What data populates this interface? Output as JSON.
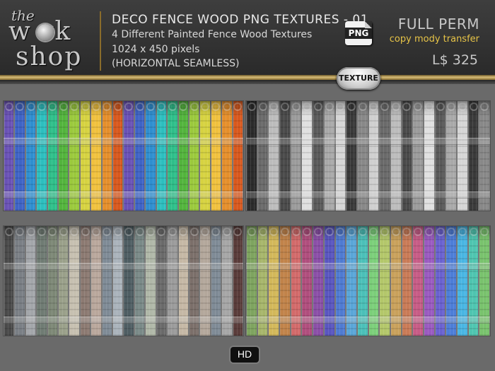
{
  "logo": {
    "line1": "the",
    "line2": "w rk",
    "line3": "shop"
  },
  "header": {
    "title": "DECO FENCE WOOD PNG TEXTURES - 01",
    "subtitle": "4 Different Painted Fence Wood Textures",
    "dimensions": "1024 x 450 pixels",
    "seamless": "(HORIZONTAL SEAMLESS)",
    "png_badge": "PNG",
    "perm_title": "FULL PERM",
    "perm_detail": "copy mody transfer",
    "price": "L$ 325"
  },
  "texture_badge": "TEXTURE",
  "hd_badge": "HD",
  "colors": {
    "accent_gold": "#d8bd78",
    "perm_yellow": "#e7c447",
    "text_light": "#e9e9e9"
  },
  "panels": [
    {
      "name": "rainbow-fence-panel",
      "planks": [
        "#6a52b6",
        "#3f64c6",
        "#2f8fd0",
        "#2dbfbf",
        "#2fbf8a",
        "#53b43d",
        "#9bc93d",
        "#d6d241",
        "#f0c13e",
        "#e58f2c",
        "#d8591e",
        "#6a52b6",
        "#3f64c6",
        "#2f8fd0",
        "#2dbfbf",
        "#2fbf8a",
        "#53b43d",
        "#9bc93d",
        "#d6d241",
        "#f0c13e",
        "#e58f2c",
        "#d8591e"
      ]
    },
    {
      "name": "grayscale-fence-panel",
      "planks": [
        "#2b2b2b",
        "#6a6a6a",
        "#bcbcbc",
        "#4a4a4a",
        "#9b9b9b",
        "#e0e0e0",
        "#5a5a5a",
        "#a9a9a9",
        "#d6d6d6",
        "#3a3a3a",
        "#888888",
        "#cfcfcf",
        "#6a6a6a",
        "#bcbcbc",
        "#4a4a4a",
        "#9b9b9b",
        "#e0e0e0",
        "#5a5a5a",
        "#a9a9a9",
        "#d6d6d6",
        "#3a3a3a",
        "#888888"
      ]
    },
    {
      "name": "muted-fence-panel",
      "planks": [
        "#4a4a4a",
        "#7a7f85",
        "#a3a6aa",
        "#6f7b73",
        "#7d8876",
        "#9aa08a",
        "#c6c0b0",
        "#8c7a72",
        "#b9a79c",
        "#7f8b96",
        "#aab3bb",
        "#4f5e63",
        "#7a8a88",
        "#b0b8a8",
        "#6a6a6a",
        "#9b9b9b",
        "#c5b8a5",
        "#7b6f6a",
        "#b3a79b",
        "#7f8b96",
        "#a6a6a6",
        "#5a3c3a"
      ]
    },
    {
      "name": "pastel-fence-panel",
      "planks": [
        "#7ea45f",
        "#a7b66b",
        "#d3b85a",
        "#c1834a",
        "#d26a6a",
        "#b04e7d",
        "#8b4fa7",
        "#5a56c0",
        "#4f7bd2",
        "#5aa6d8",
        "#4bc0b8",
        "#7ccf7a",
        "#b3c76a",
        "#c9a15b",
        "#c97b57",
        "#c75c86",
        "#9a5ac0",
        "#6a62d0",
        "#4d7ed8",
        "#49b6e3",
        "#4fc5b0",
        "#79c26d"
      ]
    }
  ]
}
